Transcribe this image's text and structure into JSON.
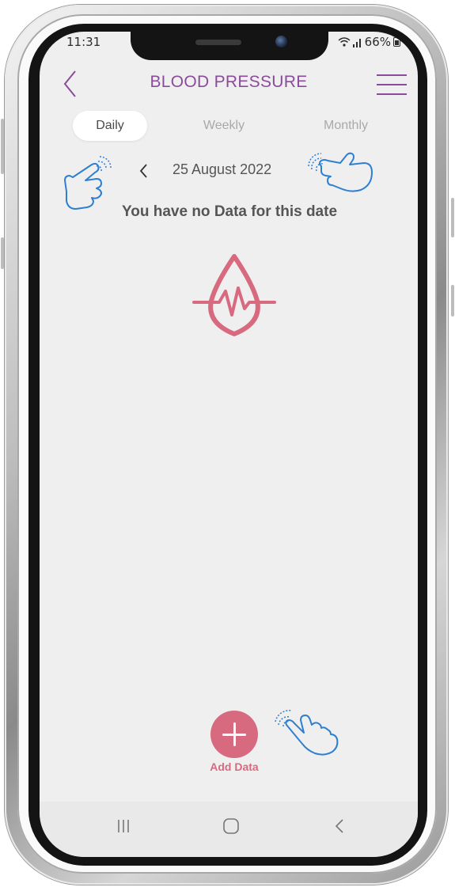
{
  "status_bar": {
    "time": "11:31",
    "battery_percent": "66%"
  },
  "header": {
    "title": "BLOOD PRESSURE",
    "back_icon": "chevron-left-icon",
    "menu_icon": "hamburger-menu-icon"
  },
  "tabs": [
    {
      "label": "Daily",
      "active": true
    },
    {
      "label": "Weekly",
      "active": false
    },
    {
      "label": "Monthly",
      "active": false
    }
  ],
  "date_nav": {
    "prev_icon": "chevron-left-icon",
    "date": "25 August 2022"
  },
  "empty_state": {
    "message": "You have no Data for this date",
    "icon": "blood-drop-pulse-icon"
  },
  "add_data": {
    "label": "Add Data",
    "icon": "plus-icon"
  },
  "system_nav": {
    "items": [
      "recent-apps-icon",
      "home-icon",
      "back-icon"
    ]
  },
  "colors": {
    "accent_purple": "#8a4c9a",
    "accent_pink": "#d86a80",
    "hint_blue": "#2f7fd0",
    "screen_bg": "#efefef"
  }
}
